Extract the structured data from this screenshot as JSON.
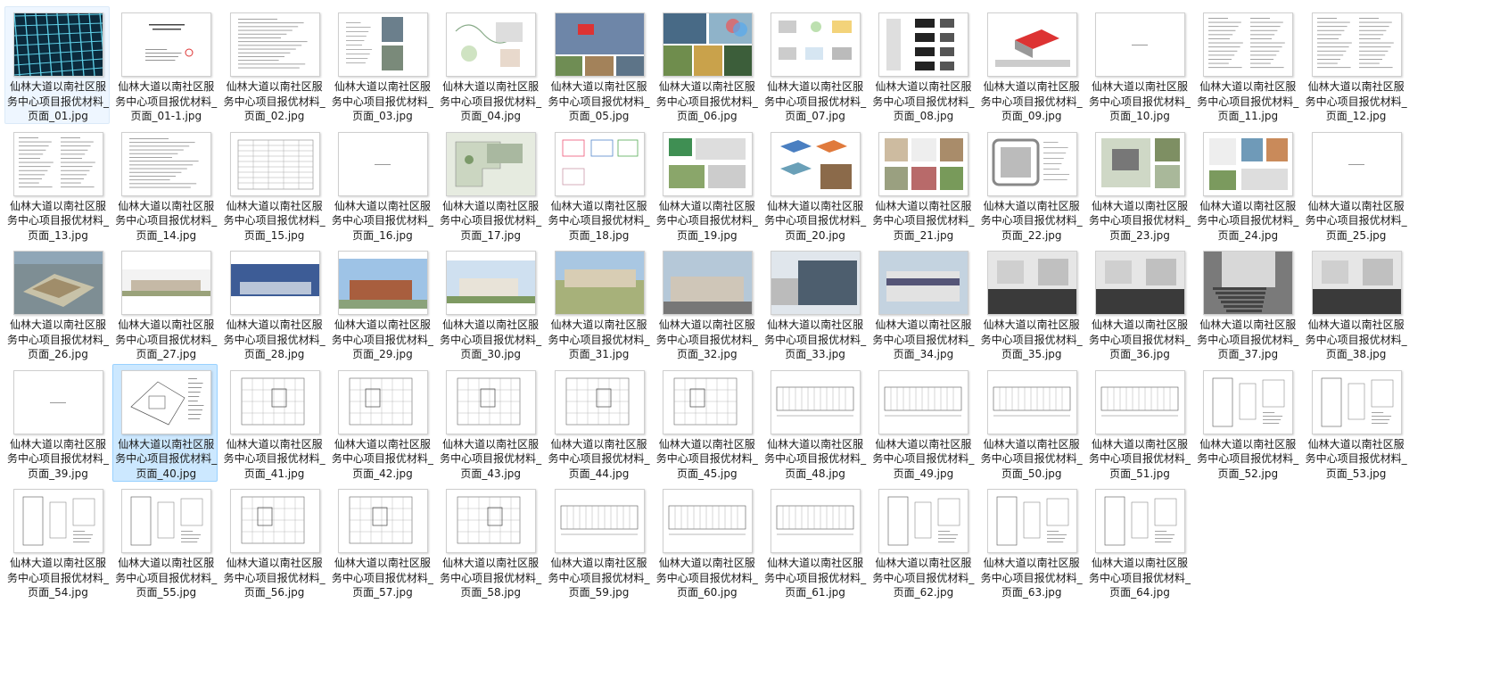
{
  "window": {
    "background": "#ffffff",
    "selection_color": "#cce8ff"
  },
  "files": [
    {
      "line1": "仙林大道以南社区服",
      "line2": "务中心项目报优材料_",
      "line3": "页面_01.jpg",
      "kind": "render-grid",
      "state": "faint"
    },
    {
      "line1": "仙林大道以南社区服",
      "line2": "务中心项目报优材料_",
      "line3": "页面_01-1.jpg",
      "kind": "cover"
    },
    {
      "line1": "仙林大道以南社区服",
      "line2": "务中心项目报优材料_",
      "line3": "页面_02.jpg",
      "kind": "text"
    },
    {
      "line1": "仙林大道以南社区服",
      "line2": "务中心项目报优材料_",
      "line3": "页面_03.jpg",
      "kind": "aerial"
    },
    {
      "line1": "仙林大道以南社区服",
      "line2": "务中心项目报优材料_",
      "line3": "页面_04.jpg",
      "kind": "diagram"
    },
    {
      "line1": "仙林大道以南社区服",
      "line2": "务中心项目报优材料_",
      "line3": "页面_05.jpg",
      "kind": "site-map"
    },
    {
      "line1": "仙林大道以南社区服",
      "line2": "务中心项目报优材料_",
      "line3": "页面_06.jpg",
      "kind": "photo-collage"
    },
    {
      "line1": "仙林大道以南社区服",
      "line2": "务中心项目报优材料_",
      "line3": "页面_07.jpg",
      "kind": "concept"
    },
    {
      "line1": "仙林大道以南社区服",
      "line2": "务中心项目报优材料_",
      "line3": "页面_08.jpg",
      "kind": "massing"
    },
    {
      "line1": "仙林大道以南社区服",
      "line2": "务中心项目报优材料_",
      "line3": "页面_09.jpg",
      "kind": "axon"
    },
    {
      "line1": "仙林大道以南社区服",
      "line2": "务中心项目报优材料_",
      "line3": "页面_10.jpg",
      "kind": "blank"
    },
    {
      "line1": "仙林大道以南社区服",
      "line2": "务中心项目报优材料_",
      "line3": "页面_11.jpg",
      "kind": "text2"
    },
    {
      "line1": "仙林大道以南社区服",
      "line2": "务中心项目报优材料_",
      "line3": "页面_12.jpg",
      "kind": "text2"
    },
    {
      "line1": "仙林大道以南社区服",
      "line2": "务中心项目报优材料_",
      "line3": "页面_13.jpg",
      "kind": "text2"
    },
    {
      "line1": "仙林大道以南社区服",
      "line2": "务中心项目报优材料_",
      "line3": "页面_14.jpg",
      "kind": "text"
    },
    {
      "line1": "仙林大道以南社区服",
      "line2": "务中心项目报优材料_",
      "line3": "页面_15.jpg",
      "kind": "table"
    },
    {
      "line1": "仙林大道以南社区服",
      "line2": "务中心项目报优材料_",
      "line3": "页面_16.jpg",
      "kind": "blank"
    },
    {
      "line1": "仙林大道以南社区服",
      "line2": "务中心项目报优材料_",
      "line3": "页面_17.jpg",
      "kind": "siteplan"
    },
    {
      "line1": "仙林大道以南社区服",
      "line2": "务中心项目报优材料_",
      "line3": "页面_18.jpg",
      "kind": "plans-color"
    },
    {
      "line1": "仙林大道以南社区服",
      "line2": "务中心项目报优材料_",
      "line3": "页面_19.jpg",
      "kind": "board-green"
    },
    {
      "line1": "仙林大道以南社区服",
      "line2": "务中心项目报优材料_",
      "line3": "页面_20.jpg",
      "kind": "exploded"
    },
    {
      "line1": "仙林大道以南社区服",
      "line2": "务中心项目报优材料_",
      "line3": "页面_21.jpg",
      "kind": "board-photos"
    },
    {
      "line1": "仙林大道以南社区服",
      "line2": "务中心项目报优材料_",
      "line3": "页面_22.jpg",
      "kind": "siteplan-road"
    },
    {
      "line1": "仙林大道以南社区服",
      "line2": "务中心项目报优材料_",
      "line3": "页面_23.jpg",
      "kind": "siteplan2"
    },
    {
      "line1": "仙林大道以南社区服",
      "line2": "务中心项目报优材料_",
      "line3": "页面_24.jpg",
      "kind": "board-mixed"
    },
    {
      "line1": "仙林大道以南社区服",
      "line2": "务中心项目报优材料_",
      "line3": "页面_25.jpg",
      "kind": "blank"
    },
    {
      "line1": "仙林大道以南社区服",
      "line2": "务中心项目报优材料_",
      "line3": "页面_26.jpg",
      "kind": "aerial-render"
    },
    {
      "line1": "仙林大道以南社区服",
      "line2": "务中心项目报优材料_",
      "line3": "页面_27.jpg",
      "kind": "elev-render"
    },
    {
      "line1": "仙林大道以南社区服",
      "line2": "务中心项目报优材料_",
      "line3": "页面_28.jpg",
      "kind": "dusk-render"
    },
    {
      "line1": "仙林大道以南社区服",
      "line2": "务中心项目报优材料_",
      "line3": "页面_29.jpg",
      "kind": "day-render"
    },
    {
      "line1": "仙林大道以南社区服",
      "line2": "务中心项目报优材料_",
      "line3": "页面_30.jpg",
      "kind": "day-render2"
    },
    {
      "line1": "仙林大道以南社区服",
      "line2": "务中心项目报优材料_",
      "line3": "页面_31.jpg",
      "kind": "court-render"
    },
    {
      "line1": "仙林大道以南社区服",
      "line2": "务中心项目报优材料_",
      "line3": "页面_32.jpg",
      "kind": "photo-bldg"
    },
    {
      "line1": "仙林大道以南社区服",
      "line2": "务中心项目报优材料_",
      "line3": "页面_33.jpg",
      "kind": "photo-bldg2"
    },
    {
      "line1": "仙林大道以南社区服",
      "line2": "务中心项目报优材料_",
      "line3": "页面_34.jpg",
      "kind": "photo-bldg3"
    },
    {
      "line1": "仙林大道以南社区服",
      "line2": "务中心项目报优材料_",
      "line3": "页面_35.jpg",
      "kind": "photo-dark"
    },
    {
      "line1": "仙林大道以南社区服",
      "line2": "务中心项目报优材料_",
      "line3": "页面_36.jpg",
      "kind": "photo-dark"
    },
    {
      "line1": "仙林大道以南社区服",
      "line2": "务中心项目报优材料_",
      "line3": "页面_37.jpg",
      "kind": "photo-stair"
    },
    {
      "line1": "仙林大道以南社区服",
      "line2": "务中心项目报优材料_",
      "line3": "页面_38.jpg",
      "kind": "photo-dark"
    },
    {
      "line1": "仙林大道以南社区服",
      "line2": "务中心项目报优材料_",
      "line3": "页面_39.jpg",
      "kind": "blank"
    },
    {
      "line1": "仙林大道以南社区服",
      "line2": "务中心项目报优材料_",
      "line3": "页面_40.jpg",
      "kind": "cad-site",
      "state": "selected"
    },
    {
      "line1": "仙林大道以南社区服",
      "line2": "务中心项目报优材料_",
      "line3": "页面_41.jpg",
      "kind": "cad-plan"
    },
    {
      "line1": "仙林大道以南社区服",
      "line2": "务中心项目报优材料_",
      "line3": "页面_42.jpg",
      "kind": "cad-plan"
    },
    {
      "line1": "仙林大道以南社区服",
      "line2": "务中心项目报优材料_",
      "line3": "页面_43.jpg",
      "kind": "cad-plan"
    },
    {
      "line1": "仙林大道以南社区服",
      "line2": "务中心项目报优材料_",
      "line3": "页面_44.jpg",
      "kind": "cad-plan"
    },
    {
      "line1": "仙林大道以南社区服",
      "line2": "务中心项目报优材料_",
      "line3": "页面_45.jpg",
      "kind": "cad-plan"
    },
    {
      "line1": "仙林大道以南社区服",
      "line2": "务中心项目报优材料_",
      "line3": "页面_48.jpg",
      "kind": "cad-elev"
    },
    {
      "line1": "仙林大道以南社区服",
      "line2": "务中心项目报优材料_",
      "line3": "页面_49.jpg",
      "kind": "cad-elev"
    },
    {
      "line1": "仙林大道以南社区服",
      "line2": "务中心项目报优材料_",
      "line3": "页面_50.jpg",
      "kind": "cad-elev"
    },
    {
      "line1": "仙林大道以南社区服",
      "line2": "务中心项目报优材料_",
      "line3": "页面_51.jpg",
      "kind": "cad-elev"
    },
    {
      "line1": "仙林大道以南社区服",
      "line2": "务中心项目报优材料_",
      "line3": "页面_52.jpg",
      "kind": "cad-detail"
    },
    {
      "line1": "仙林大道以南社区服",
      "line2": "务中心项目报优材料_",
      "line3": "页面_53.jpg",
      "kind": "cad-detail"
    },
    {
      "line1": "仙林大道以南社区服",
      "line2": "务中心项目报优材料_",
      "line3": "页面_54.jpg",
      "kind": "cad-detail"
    },
    {
      "line1": "仙林大道以南社区服",
      "line2": "务中心项目报优材料_",
      "line3": "页面_55.jpg",
      "kind": "cad-detail"
    },
    {
      "line1": "仙林大道以南社区服",
      "line2": "务中心项目报优材料_",
      "line3": "页面_56.jpg",
      "kind": "cad-plan"
    },
    {
      "line1": "仙林大道以南社区服",
      "line2": "务中心项目报优材料_",
      "line3": "页面_57.jpg",
      "kind": "cad-plan"
    },
    {
      "line1": "仙林大道以南社区服",
      "line2": "务中心项目报优材料_",
      "line3": "页面_58.jpg",
      "kind": "cad-plan"
    },
    {
      "line1": "仙林大道以南社区服",
      "line2": "务中心项目报优材料_",
      "line3": "页面_59.jpg",
      "kind": "cad-elev"
    },
    {
      "line1": "仙林大道以南社区服",
      "line2": "务中心项目报优材料_",
      "line3": "页面_60.jpg",
      "kind": "cad-elev"
    },
    {
      "line1": "仙林大道以南社区服",
      "line2": "务中心项目报优材料_",
      "line3": "页面_61.jpg",
      "kind": "cad-elev"
    },
    {
      "line1": "仙林大道以南社区服",
      "line2": "务中心项目报优材料_",
      "line3": "页面_62.jpg",
      "kind": "cad-detail"
    },
    {
      "line1": "仙林大道以南社区服",
      "line2": "务中心项目报优材料_",
      "line3": "页面_63.jpg",
      "kind": "cad-detail"
    },
    {
      "line1": "仙林大道以南社区服",
      "line2": "务中心项目报优材料_",
      "line3": "页面_64.jpg",
      "kind": "cad-detail"
    }
  ]
}
